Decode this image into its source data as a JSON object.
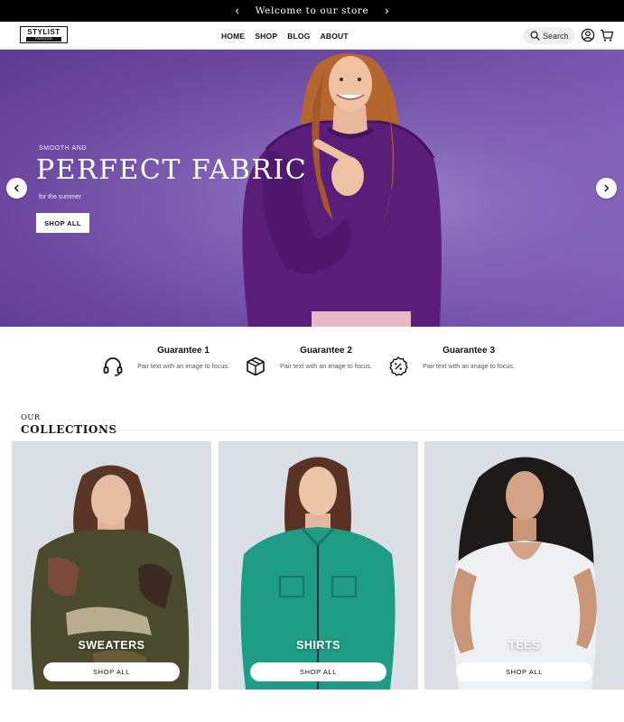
{
  "announcement": {
    "message": "Welcome to our store",
    "prev": "‹",
    "next": "›"
  },
  "header": {
    "logo": {
      "main": "STYLIST",
      "sub": "FASHION"
    },
    "nav": [
      "HOME",
      "SHOP",
      "BLOG",
      "ABOUT"
    ],
    "search_label": "Search",
    "icons": [
      "search-icon",
      "account-icon",
      "cart-icon"
    ]
  },
  "hero": {
    "eyebrow": "SMOOTH AND",
    "title": "PERFECT FABRIC",
    "subtitle": "for the summer",
    "button": "SHOP ALL",
    "prev_arrow": "‹",
    "next_arrow": "›",
    "colors": {
      "background": "#6b479f",
      "sweater": "#5a1d7a",
      "hair": "#b5652e"
    }
  },
  "guarantees": [
    {
      "title": "Guarantee 1",
      "text": "Pair text with an image to focus.",
      "icon": "headset-icon"
    },
    {
      "title": "Guarantee 2",
      "text": "Pair text with an image to focus.",
      "icon": "box-icon"
    },
    {
      "title": "Guarantee 3",
      "text": "Pair text with an image to focus.",
      "icon": "discount-badge-icon"
    }
  ],
  "collections": {
    "heading_small": "OUR",
    "heading_big": "COLLECTIONS",
    "items": [
      {
        "label": "SWEATERS",
        "button": "SHOP ALL",
        "garment_color": "#4a4a2e"
      },
      {
        "label": "SHIRTS",
        "button": "SHOP ALL",
        "garment_color": "#1e9c86"
      },
      {
        "label": "TEES",
        "button": "SHOP ALL",
        "garment_color": "#eef0f3"
      }
    ]
  }
}
